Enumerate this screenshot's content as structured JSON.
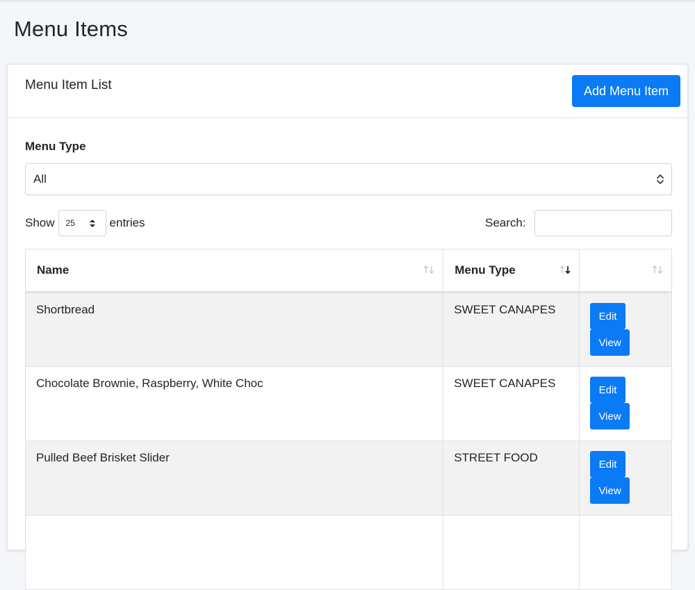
{
  "page": {
    "title": "Menu Items"
  },
  "card": {
    "title": "Menu Item List",
    "add_label": "Add Menu Item"
  },
  "filter": {
    "label": "Menu Type",
    "selected": "All"
  },
  "length": {
    "prefix": "Show",
    "value": "25",
    "suffix": "entries"
  },
  "search": {
    "label": "Search:",
    "value": ""
  },
  "table": {
    "columns": [
      "Name",
      "Menu Type",
      ""
    ],
    "rows": [
      {
        "name": "Shortbread",
        "type": "SWEET CANAPES",
        "edit": "Edit",
        "view": "View"
      },
      {
        "name": "Chocolate Brownie, Raspberry, White Choc",
        "type": "SWEET CANAPES",
        "edit": "Edit",
        "view": "View"
      },
      {
        "name": "Pulled Beef Brisket Slider",
        "type": "STREET FOOD",
        "edit": "Edit",
        "view": "View"
      },
      {
        "name": "",
        "type": "",
        "edit": "",
        "view": ""
      }
    ]
  },
  "colors": {
    "primary": "#0a7bf5",
    "stripe": "#f2f2f2"
  }
}
